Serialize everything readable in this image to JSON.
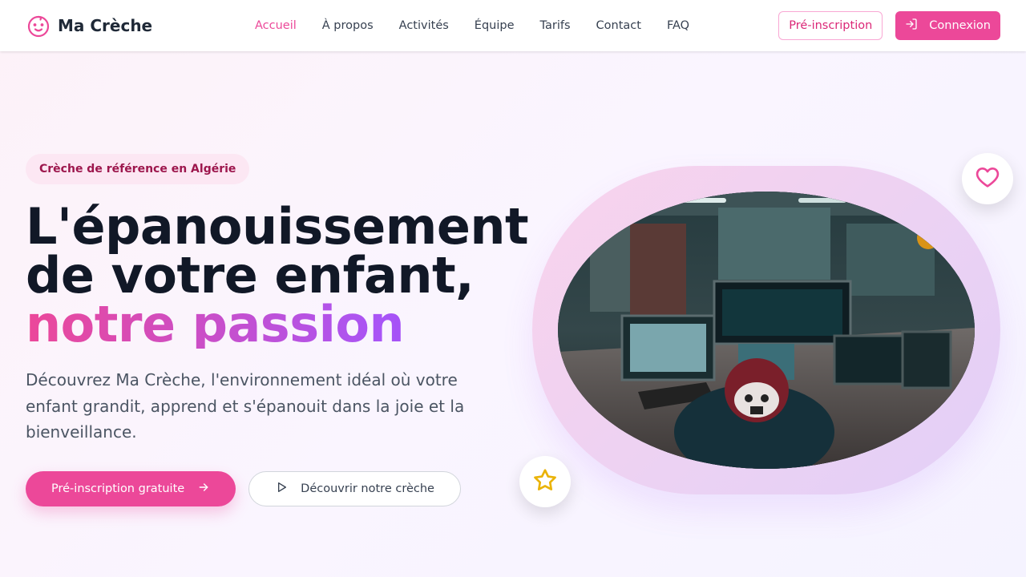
{
  "brand": {
    "name": "Ma Crèche",
    "icon": "baby-face-icon",
    "color": "#ec4899"
  },
  "nav": {
    "items": [
      {
        "label": "Accueil",
        "active": true
      },
      {
        "label": "À propos"
      },
      {
        "label": "Activités"
      },
      {
        "label": "Équipe"
      },
      {
        "label": "Tarifs"
      },
      {
        "label": "Contact"
      },
      {
        "label": "FAQ"
      }
    ]
  },
  "header": {
    "preinscription_label": "Pré-inscription",
    "login_label": "Connexion",
    "login_icon": "login-icon"
  },
  "hero": {
    "badge": "Crèche de référence en Algérie",
    "title_line1": "L'épanouissement",
    "title_line2": "de votre enfant,",
    "title_highlight": "notre passion",
    "description": "Découvrez Ma Crèche, l'environnement idéal où votre enfant grandit, apprend et s'épanouit dans la joie et la bienveillance.",
    "primary_cta": "Pré-inscription gratuite",
    "secondary_cta": "Découvrir notre crèche"
  },
  "decorations": {
    "heart_icon": "heart-icon",
    "star_icon": "star-icon"
  },
  "colors": {
    "accent": "#ec4899",
    "accent_purple": "#a855f7",
    "star": "#eab308",
    "title": "#111827",
    "text": "#4b5563"
  }
}
